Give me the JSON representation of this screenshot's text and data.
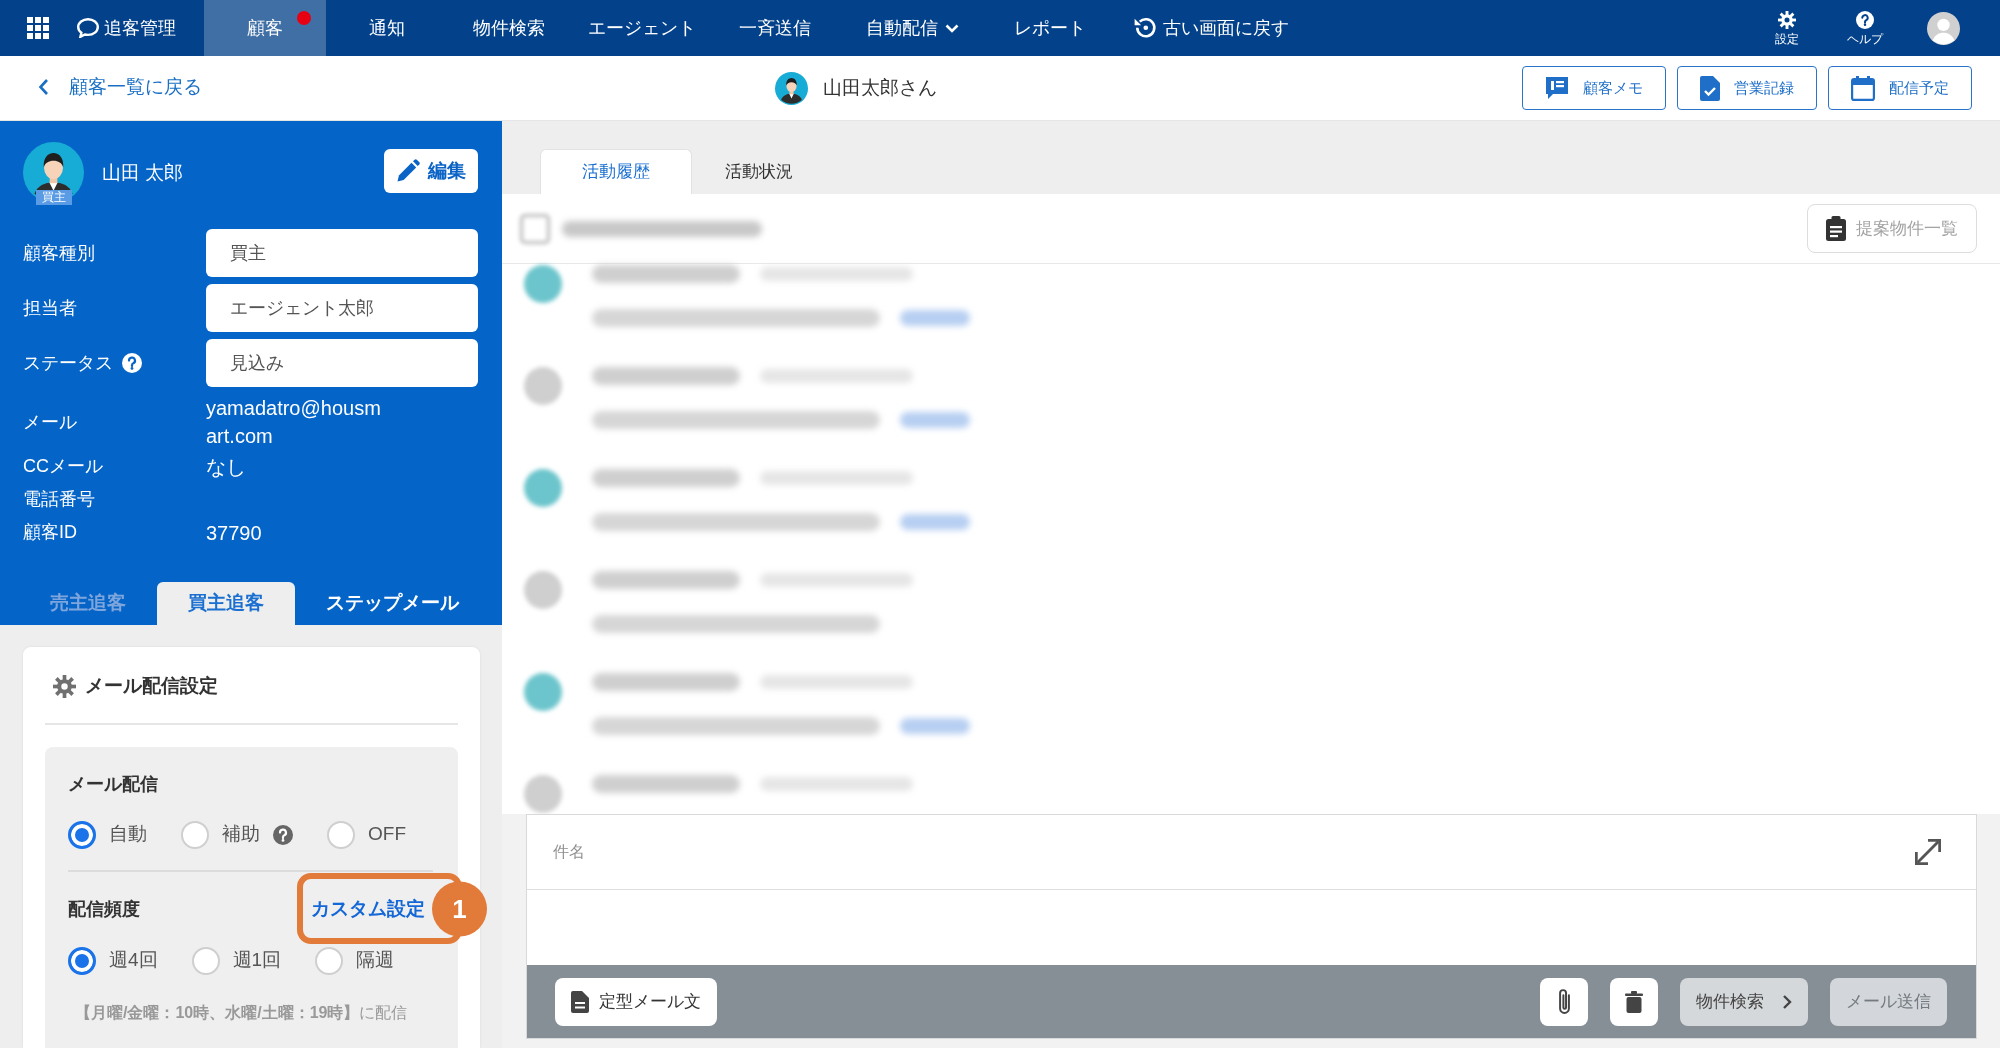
{
  "top_nav": {
    "brand": "追客管理",
    "items": [
      {
        "label": "顧客",
        "selected": true,
        "notification": true,
        "dropdown": false
      },
      {
        "label": "通知",
        "selected": false,
        "notification": false,
        "dropdown": false
      },
      {
        "label": "物件検索",
        "selected": false,
        "notification": false,
        "dropdown": false
      },
      {
        "label": "エージェント",
        "selected": false,
        "notification": false,
        "dropdown": false
      },
      {
        "label": "一斉送信",
        "selected": false,
        "notification": false,
        "dropdown": false
      },
      {
        "label": "自動配信",
        "selected": false,
        "notification": false,
        "dropdown": true
      },
      {
        "label": "レポート",
        "selected": false,
        "notification": false,
        "dropdown": false
      }
    ],
    "legacy_link": "古い画面に戻す",
    "utilities": [
      {
        "label": "設定",
        "kind": "settings"
      },
      {
        "label": "ヘルプ",
        "kind": "help"
      }
    ]
  },
  "subheader": {
    "back_link": "顧客一覧に戻る",
    "customer_name": "山田太郎さん",
    "actions": [
      {
        "label": "顧客メモ",
        "kind": "memo"
      },
      {
        "label": "営業記録",
        "kind": "record"
      },
      {
        "label": "配信予定",
        "kind": "schedule"
      }
    ]
  },
  "customer_panel": {
    "name": "山田 太郎",
    "avatar_badge": "買主",
    "edit_button": "編集",
    "fields": [
      {
        "label": "顧客種別",
        "value": "買主",
        "kind": "input",
        "help": false
      },
      {
        "label": "担当者",
        "value": "エージェント太郎",
        "kind": "input",
        "help": false
      },
      {
        "label": "ステータス",
        "value": "見込み",
        "kind": "input",
        "help": true
      },
      {
        "label": "メール",
        "value": "yamadatro@housmart.com",
        "kind": "text",
        "help": false
      },
      {
        "label": "CCメール",
        "value": "なし",
        "kind": "text",
        "help": false
      },
      {
        "label": "電話番号",
        "kind": "text",
        "help": false
      },
      {
        "label": "顧客ID",
        "value": "37790",
        "kind": "text",
        "help": false
      }
    ],
    "tabs": [
      {
        "label": "売主追客",
        "selected": false,
        "disabled": true
      },
      {
        "label": "買主追客",
        "selected": true,
        "disabled": false
      },
      {
        "label": "ステップメール",
        "selected": false,
        "disabled": false
      }
    ]
  },
  "mail_settings": {
    "title": "メール配信設定",
    "delivery": {
      "label": "メール配信",
      "options": [
        {
          "label": "自動",
          "selected": true,
          "help": false
        },
        {
          "label": "補助",
          "selected": false,
          "help": true
        },
        {
          "label": "OFF",
          "selected": false,
          "help": false
        }
      ]
    },
    "frequency": {
      "label": "配信頻度",
      "custom_link": {
        "label": "カスタム設定",
        "highlighted": true,
        "callout": "1"
      },
      "options": [
        {
          "label": "週4回",
          "selected": true
        },
        {
          "label": "週1回",
          "selected": false
        },
        {
          "label": "隔週",
          "selected": false
        }
      ],
      "note": "**【月曜/金曜：10時、水曜/土曜：19時】**に配信"
    }
  },
  "activity": {
    "tabs": [
      {
        "label": "活動履歴",
        "selected": true
      },
      {
        "label": "活動状況",
        "selected": false
      }
    ],
    "proposal_button": {
      "label": "提案物件一覧",
      "disabled": true
    },
    "entries": [
      {
        "color": "#6cc5cc",
        "kind": "full",
        "link": true
      },
      {
        "color": "#cfcfcf",
        "kind": "full",
        "link": true
      },
      {
        "color": "#6cc5cc",
        "kind": "full",
        "link": true
      },
      {
        "color": "#cfcfcf",
        "kind": "full",
        "link": false
      },
      {
        "color": "#6cc5cc",
        "kind": "full",
        "link": true
      },
      {
        "color": "#cfcfcf",
        "kind": "partial",
        "link": false
      }
    ]
  },
  "composer": {
    "subject_placeholder": "件名",
    "template_button": "定型メール文",
    "actions": [
      {
        "kind": "attach",
        "disabled": false
      },
      {
        "kind": "delete",
        "disabled": false
      },
      {
        "kind": "search",
        "label": "物件検索",
        "disabled": false
      },
      {
        "kind": "send",
        "label": "メール送信",
        "disabled": true
      }
    ]
  }
}
